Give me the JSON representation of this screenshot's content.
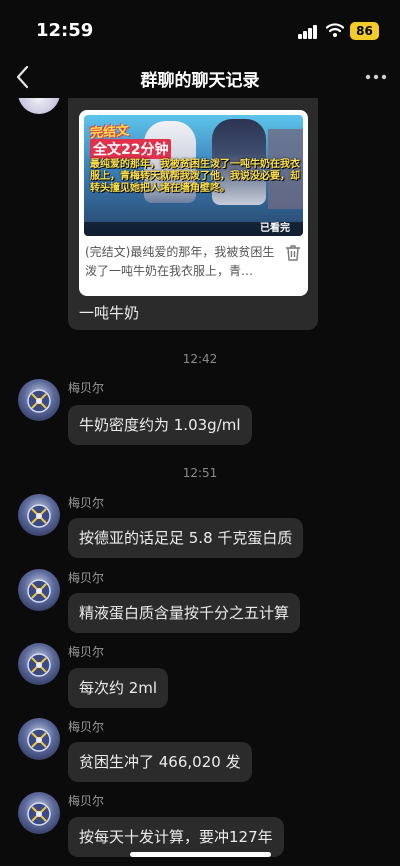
{
  "status_bar": {
    "time": "12:59",
    "battery": "86"
  },
  "header": {
    "title": "群聊的聊天记录"
  },
  "link_card": {
    "cover_tag_1": "完结文",
    "cover_tag_2": "全文22分钟",
    "cover_text": "最纯爱的那年，我被贫困生泼了一吨牛奶在我衣服上，青梅转天就帮我泼了他，我说没必要，却转头撞见她把人堵在墙角壁咚。",
    "cover_badge": "已看完",
    "description": "(完结文)最纯爱的那年，我被贫困生泼了一吨牛奶在我衣服上，青…",
    "caption": "一吨牛奶"
  },
  "timestamps": [
    "12:42",
    "12:51"
  ],
  "messages": [
    {
      "sender": "梅贝尔",
      "text": "牛奶密度约为 1.03g/ml"
    },
    {
      "sender": "梅贝尔",
      "text": "按德亚的话足足 5.8 千克蛋白质"
    },
    {
      "sender": "梅贝尔",
      "text": "精液蛋白质含量按千分之五计算"
    },
    {
      "sender": "梅贝尔",
      "text": "每次约 2ml"
    },
    {
      "sender": "梅贝尔",
      "text": "贫困生冲了 466,020 发"
    },
    {
      "sender": "梅贝尔",
      "text": "按每天十发计算，要冲127年"
    }
  ]
}
